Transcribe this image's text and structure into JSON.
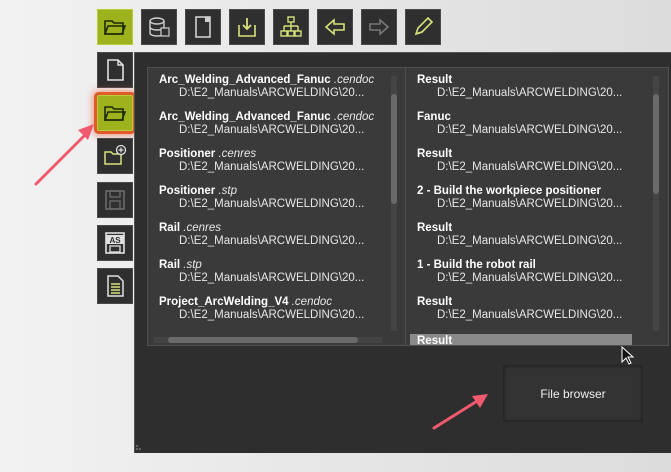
{
  "accent_color": "#9eb21e",
  "toolbar": {
    "buttons": [
      {
        "icon": "open-folder-icon",
        "active": true
      },
      {
        "icon": "database-icon",
        "active": false
      },
      {
        "icon": "document-icon",
        "active": false
      },
      {
        "icon": "import-icon",
        "active": false
      },
      {
        "icon": "hierarchy-icon",
        "active": false
      },
      {
        "icon": "arrow-left-icon",
        "active": false
      },
      {
        "icon": "arrow-right-icon",
        "active": false
      },
      {
        "icon": "pencil-icon",
        "active": false
      }
    ]
  },
  "sidebar": {
    "buttons": [
      {
        "icon": "new-file-icon",
        "active": false
      },
      {
        "icon": "open-folder-icon",
        "active": true
      },
      {
        "icon": "add-folder-icon",
        "active": false
      },
      {
        "icon": "save-icon",
        "active": false
      },
      {
        "icon": "save-as-icon",
        "label": "AS",
        "active": false
      },
      {
        "icon": "file-list-icon",
        "active": false
      }
    ]
  },
  "recent_files": [
    {
      "name": "Arc_Welding_Advanced_Fanuc ",
      "ext": ".cendoc",
      "path": "D:\\E2_Manuals\\ARCWELDING\\20..."
    },
    {
      "name": "Arc_Welding_Advanced_Fanuc ",
      "ext": ".cendoc",
      "path": "D:\\E2_Manuals\\ARCWELDING\\20..."
    },
    {
      "name": "Positioner ",
      "ext": ".cenres",
      "path": "D:\\E2_Manuals\\ARCWELDING\\20..."
    },
    {
      "name": "Positioner ",
      "ext": ".stp",
      "path": "D:\\E2_Manuals\\ARCWELDING\\20..."
    },
    {
      "name": "Rail ",
      "ext": ".cenres",
      "path": "D:\\E2_Manuals\\ARCWELDING\\20..."
    },
    {
      "name": "Rail ",
      "ext": ".stp",
      "path": "D:\\E2_Manuals\\ARCWELDING\\20..."
    },
    {
      "name": "Project_ArcWelding_V4 ",
      "ext": ".cendoc",
      "path": "D:\\E2_Manuals\\ARCWELDING\\20..."
    }
  ],
  "recent_folders": [
    {
      "name": "Result",
      "path": "D:\\E2_Manuals\\ARCWELDING\\20..."
    },
    {
      "name": "Fanuc",
      "path": "D:\\E2_Manuals\\ARCWELDING\\20..."
    },
    {
      "name": "Result",
      "path": "D:\\E2_Manuals\\ARCWELDING\\20..."
    },
    {
      "name": "2 - Build the workpiece positioner",
      "path": "D:\\E2_Manuals\\ARCWELDING\\20..."
    },
    {
      "name": "Result",
      "path": "D:\\E2_Manuals\\ARCWELDING\\20..."
    },
    {
      "name": "1 - Build the robot rail",
      "path": "D:\\E2_Manuals\\ARCWELDING\\20..."
    },
    {
      "name": "Result",
      "path": "D:\\E2_Manuals\\ARCWELDING\\20..."
    }
  ],
  "selected_folder": "Result",
  "file_browser_label": "File browser"
}
